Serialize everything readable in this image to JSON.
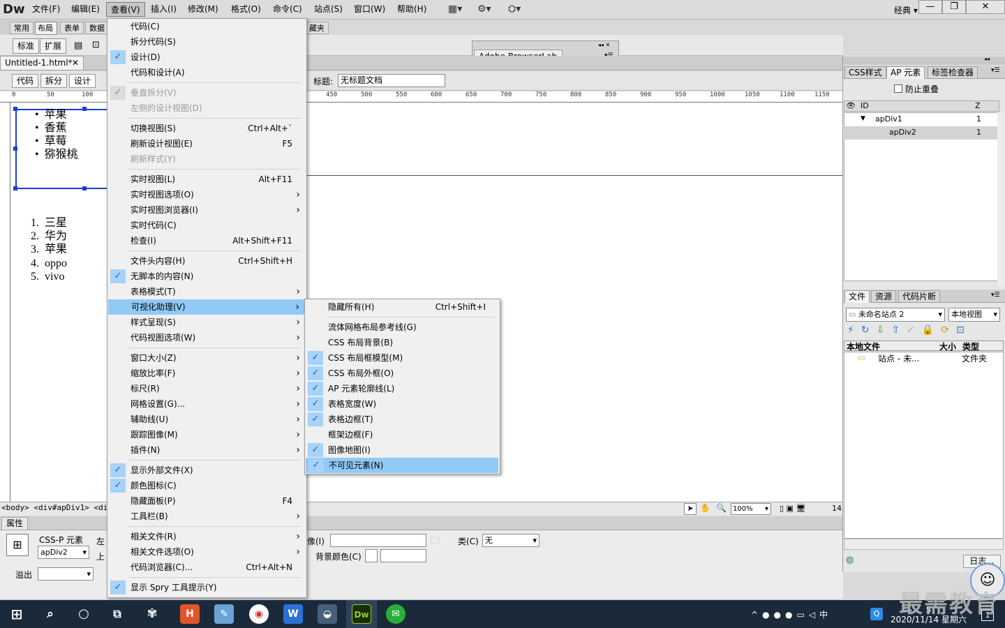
{
  "app": {
    "logo": "Dw",
    "workspace": "经典"
  },
  "menubar": [
    "文件(F)",
    "编辑(E)",
    "查看(V)",
    "插入(I)",
    "修改(M)",
    "格式(O)",
    "命令(C)",
    "站点(S)",
    "窗口(W)",
    "帮助(H)"
  ],
  "insert_tabs": [
    "常用",
    "布局",
    "表单",
    "数据"
  ],
  "insert_tab_partial": "藏夹",
  "layout_buttons": [
    "标准",
    "扩展"
  ],
  "document": {
    "tab": "Untitled-1.html*",
    "view_buttons": [
      "代码",
      "拆分",
      "设计"
    ],
    "title_label": "标题:",
    "title_value": "无标题文档"
  },
  "ruler_ticks": [
    "0",
    "50",
    "100",
    "450",
    "500",
    "550",
    "600",
    "650",
    "700",
    "750",
    "800",
    "850",
    "900",
    "950",
    "1000",
    "1050",
    "1100",
    "1150"
  ],
  "content": {
    "unordered": [
      "苹果",
      "香蕉",
      "草莓",
      "猕猴桃"
    ],
    "ordered": [
      {
        "n": "1.",
        "t": "三星"
      },
      {
        "n": "2.",
        "t": "华为"
      },
      {
        "n": "3.",
        "t": "苹果"
      },
      {
        "n": "4.",
        "t": "oppo"
      },
      {
        "n": "5.",
        "t": "vivo"
      }
    ]
  },
  "status": {
    "tag_selector": "<body> <div#apDiv1> <div#a",
    "zoom": "100%",
    "size_partial": "14"
  },
  "properties": {
    "tab": "属性",
    "element_label": "CSS-P 元素",
    "element_id": "apDiv2",
    "left_label": "左",
    "top_label": "上",
    "overflow_label": "溢出",
    "image_label": "像(I)",
    "class_label": "类(C)",
    "class_value": "无",
    "bg_color_label": "背景颜色(C)"
  },
  "browserlab": {
    "title": "Adobe BrowserLab"
  },
  "ap_panel": {
    "tabs": [
      "CSS样式",
      "AP 元素",
      "标签检查器"
    ],
    "prevent_overlap": "防止重叠",
    "columns": [
      "ID",
      "Z"
    ],
    "rows": [
      {
        "id": "apDiv1",
        "z": "1"
      },
      {
        "id": "apDiv2",
        "z": "1"
      }
    ]
  },
  "files_panel": {
    "tabs": [
      "文件",
      "资源",
      "代码片断"
    ],
    "site": "未命名站点 2",
    "view": "本地视图",
    "columns": [
      "本地文件",
      "大小",
      "类型"
    ],
    "rows": [
      {
        "name": "站点 - 未...",
        "type": "文件夹"
      }
    ],
    "log_button": "日志..."
  },
  "view_menu": [
    {
      "label": "代码(C)"
    },
    {
      "label": "拆分代码(S)"
    },
    {
      "label": "设计(D)",
      "checked": true
    },
    {
      "label": "代码和设计(A)"
    },
    {
      "sep": true
    },
    {
      "label": "垂直拆分(V)",
      "checked": true,
      "disabled": true
    },
    {
      "label": "左侧的设计视图(D)",
      "disabled": true
    },
    {
      "sep": true
    },
    {
      "label": "切换视图(S)",
      "shortcut": "Ctrl+Alt+`"
    },
    {
      "label": "刷新设计视图(E)",
      "shortcut": "F5"
    },
    {
      "label": "刷新样式(Y)",
      "disabled": true
    },
    {
      "sep": true
    },
    {
      "label": "实时视图(L)",
      "shortcut": "Alt+F11"
    },
    {
      "label": "实时视图选项(O)",
      "sub": true
    },
    {
      "label": "实时视图浏览器(I)",
      "sub": true
    },
    {
      "label": "实时代码(C)"
    },
    {
      "label": "检查(I)",
      "shortcut": "Alt+Shift+F11"
    },
    {
      "sep": true
    },
    {
      "label": "文件头内容(H)",
      "shortcut": "Ctrl+Shift+H"
    },
    {
      "label": "无脚本的内容(N)",
      "checked": true
    },
    {
      "label": "表格模式(T)",
      "sub": true
    },
    {
      "label": "可视化助理(V)",
      "sub": true,
      "highlight": true
    },
    {
      "label": "样式呈现(S)",
      "sub": true
    },
    {
      "label": "代码视图选项(W)",
      "sub": true
    },
    {
      "sep": true
    },
    {
      "label": "窗口大小(Z)",
      "sub": true
    },
    {
      "label": "缩放比率(F)",
      "sub": true
    },
    {
      "label": "标尺(R)",
      "sub": true
    },
    {
      "label": "网格设置(G)...",
      "sub": true
    },
    {
      "label": "辅助线(U)",
      "sub": true
    },
    {
      "label": "跟踪图像(M)",
      "sub": true
    },
    {
      "label": "插件(N)",
      "sub": true
    },
    {
      "sep": true
    },
    {
      "label": "显示外部文件(X)",
      "checked": true
    },
    {
      "label": "颜色图标(C)",
      "checked": true
    },
    {
      "label": "隐藏面板(P)",
      "shortcut": "F4"
    },
    {
      "label": "工具栏(B)",
      "sub": true
    },
    {
      "sep": true
    },
    {
      "label": "相关文件(R)",
      "sub": true
    },
    {
      "label": "相关文件选项(O)",
      "sub": true
    },
    {
      "label": "代码浏览器(C)...",
      "shortcut": "Ctrl+Alt+N"
    },
    {
      "sep": true
    },
    {
      "label": "显示 Spry 工具提示(Y)",
      "checked": true
    }
  ],
  "visual_aids_menu": [
    {
      "label": "隐藏所有(H)",
      "shortcut": "Ctrl+Shift+I"
    },
    {
      "sep": true
    },
    {
      "label": "流体网格布局参考线(G)"
    },
    {
      "label": "CSS 布局背景(B)"
    },
    {
      "label": "CSS 布局框模型(M)",
      "checked": true
    },
    {
      "label": "CSS 布局外框(O)",
      "checked": true
    },
    {
      "label": "AP 元素轮廓线(L)",
      "checked": true
    },
    {
      "label": "表格宽度(W)",
      "checked": true
    },
    {
      "label": "表格边框(T)",
      "checked": true
    },
    {
      "label": "框架边框(F)"
    },
    {
      "label": "图像地图(I)",
      "checked": true
    },
    {
      "label": "不可见元素(N)",
      "checked": true,
      "highlight": true
    }
  ],
  "taskbar": {
    "time_partial": "5",
    "date": "2020/11/14 星期六",
    "ime": "中",
    "notification_count": "1",
    "watermark": "最需教育"
  }
}
